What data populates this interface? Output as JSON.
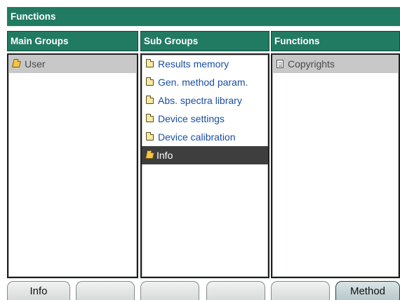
{
  "window": {
    "title": "Functions"
  },
  "columns": {
    "main_groups": {
      "header": "Main Groups",
      "items": [
        {
          "label": "User",
          "icon": "folder-open-icon",
          "state": "selected"
        }
      ]
    },
    "sub_groups": {
      "header": "Sub Groups",
      "items": [
        {
          "label": "Results memory",
          "icon": "folder-icon"
        },
        {
          "label": "Gen. method param.",
          "icon": "folder-icon"
        },
        {
          "label": "Abs. spectra library",
          "icon": "folder-icon"
        },
        {
          "label": "Device settings",
          "icon": "folder-icon"
        },
        {
          "label": "Device calibration",
          "icon": "folder-icon"
        },
        {
          "label": "Info",
          "icon": "folder-open-icon",
          "state": "focused"
        }
      ]
    },
    "functions": {
      "header": "Functions",
      "items": [
        {
          "label": "Copyrights",
          "icon": "document-icon",
          "state": "selected"
        }
      ]
    }
  },
  "softkeys": [
    {
      "label": "Info"
    },
    {
      "label": ""
    },
    {
      "label": ""
    },
    {
      "label": ""
    },
    {
      "label": ""
    },
    {
      "label": "Method",
      "state": "active"
    }
  ],
  "colors": {
    "header_green": "#217a62",
    "link_blue": "#1a4fa0",
    "selection_grey": "#c8c8c8",
    "focus_dark": "#3e3e3e"
  }
}
